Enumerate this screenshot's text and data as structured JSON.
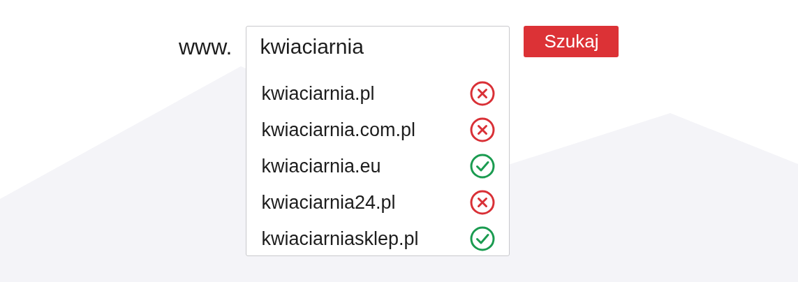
{
  "domain_prefix": "www.",
  "search": {
    "value": "kwiaciarnia"
  },
  "results": [
    {
      "domain": "kwiaciarnia.pl",
      "available": false
    },
    {
      "domain": "kwiaciarnia.com.pl",
      "available": false
    },
    {
      "domain": "kwiaciarnia.eu",
      "available": true
    },
    {
      "domain": "kwiaciarnia24.pl",
      "available": false
    },
    {
      "domain": "kwiaciarniasklep.pl",
      "available": true
    }
  ],
  "button": "Szukaj"
}
